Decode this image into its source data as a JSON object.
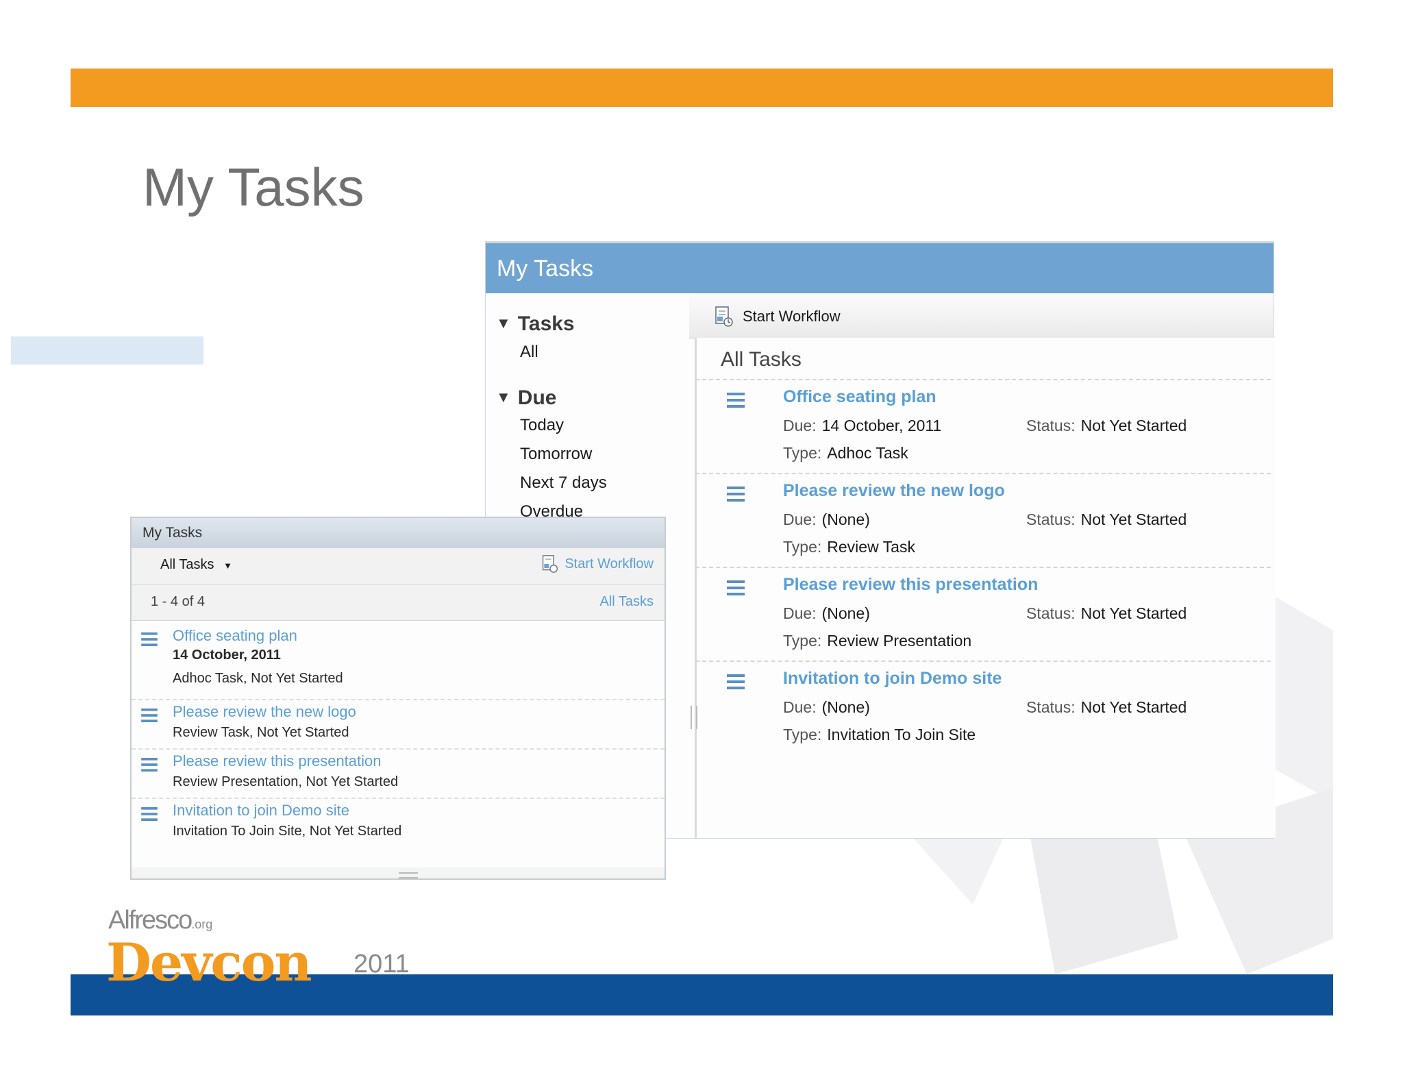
{
  "slide": {
    "title": "My Tasks",
    "logo": {
      "brand": "Alfresco",
      "brand_suffix": ".org",
      "event": "Devcon",
      "year": "2011"
    }
  },
  "colors": {
    "orange": "#f39a21",
    "blue_bar": "#0e5197",
    "dashlet_header": "#6fa4d2",
    "link": "#5a9fd4"
  },
  "big_dashlet": {
    "title": "My Tasks",
    "toolbar": {
      "start_workflow_label": "Start Workflow",
      "icon": "workflow-icon"
    },
    "filters": {
      "tasks_heading": "Tasks",
      "tasks_items": [
        "All"
      ],
      "due_heading": "Due",
      "due_items": [
        "Today",
        "Tomorrow",
        "Next 7 days",
        "Overdue"
      ]
    },
    "list_title": "All Tasks",
    "labels": {
      "due": "Due:",
      "status": "Status:",
      "type": "Type:"
    },
    "tasks": [
      {
        "title": "Office seating plan",
        "due": "14 October, 2011",
        "status": "Not Yet Started",
        "type": "Adhoc Task"
      },
      {
        "title": "Please review the new logo",
        "due": "(None)",
        "status": "Not Yet Started",
        "type": "Review Task"
      },
      {
        "title": "Please review this presentation",
        "due": "(None)",
        "status": "Not Yet Started",
        "type": "Review Presentation"
      },
      {
        "title": "Invitation to join Demo site",
        "due": "(None)",
        "status": "Not Yet Started",
        "type": "Invitation To Join Site"
      }
    ]
  },
  "small_dashlet": {
    "title": "My Tasks",
    "filter_select": "All Tasks",
    "start_workflow_label": "Start Workflow",
    "paging": "1 - 4 of 4",
    "all_tasks_link": "All Tasks",
    "tasks": [
      {
        "title": "Office seating plan",
        "due": "14 October, 2011",
        "meta": "Adhoc Task, Not Yet Started"
      },
      {
        "title": "Please review the new logo",
        "meta": "Review Task, Not Yet Started"
      },
      {
        "title": "Please review this presentation",
        "meta": "Review Presentation, Not Yet Started"
      },
      {
        "title": "Invitation to join Demo site",
        "meta": "Invitation To Join Site, Not Yet Started"
      }
    ]
  }
}
